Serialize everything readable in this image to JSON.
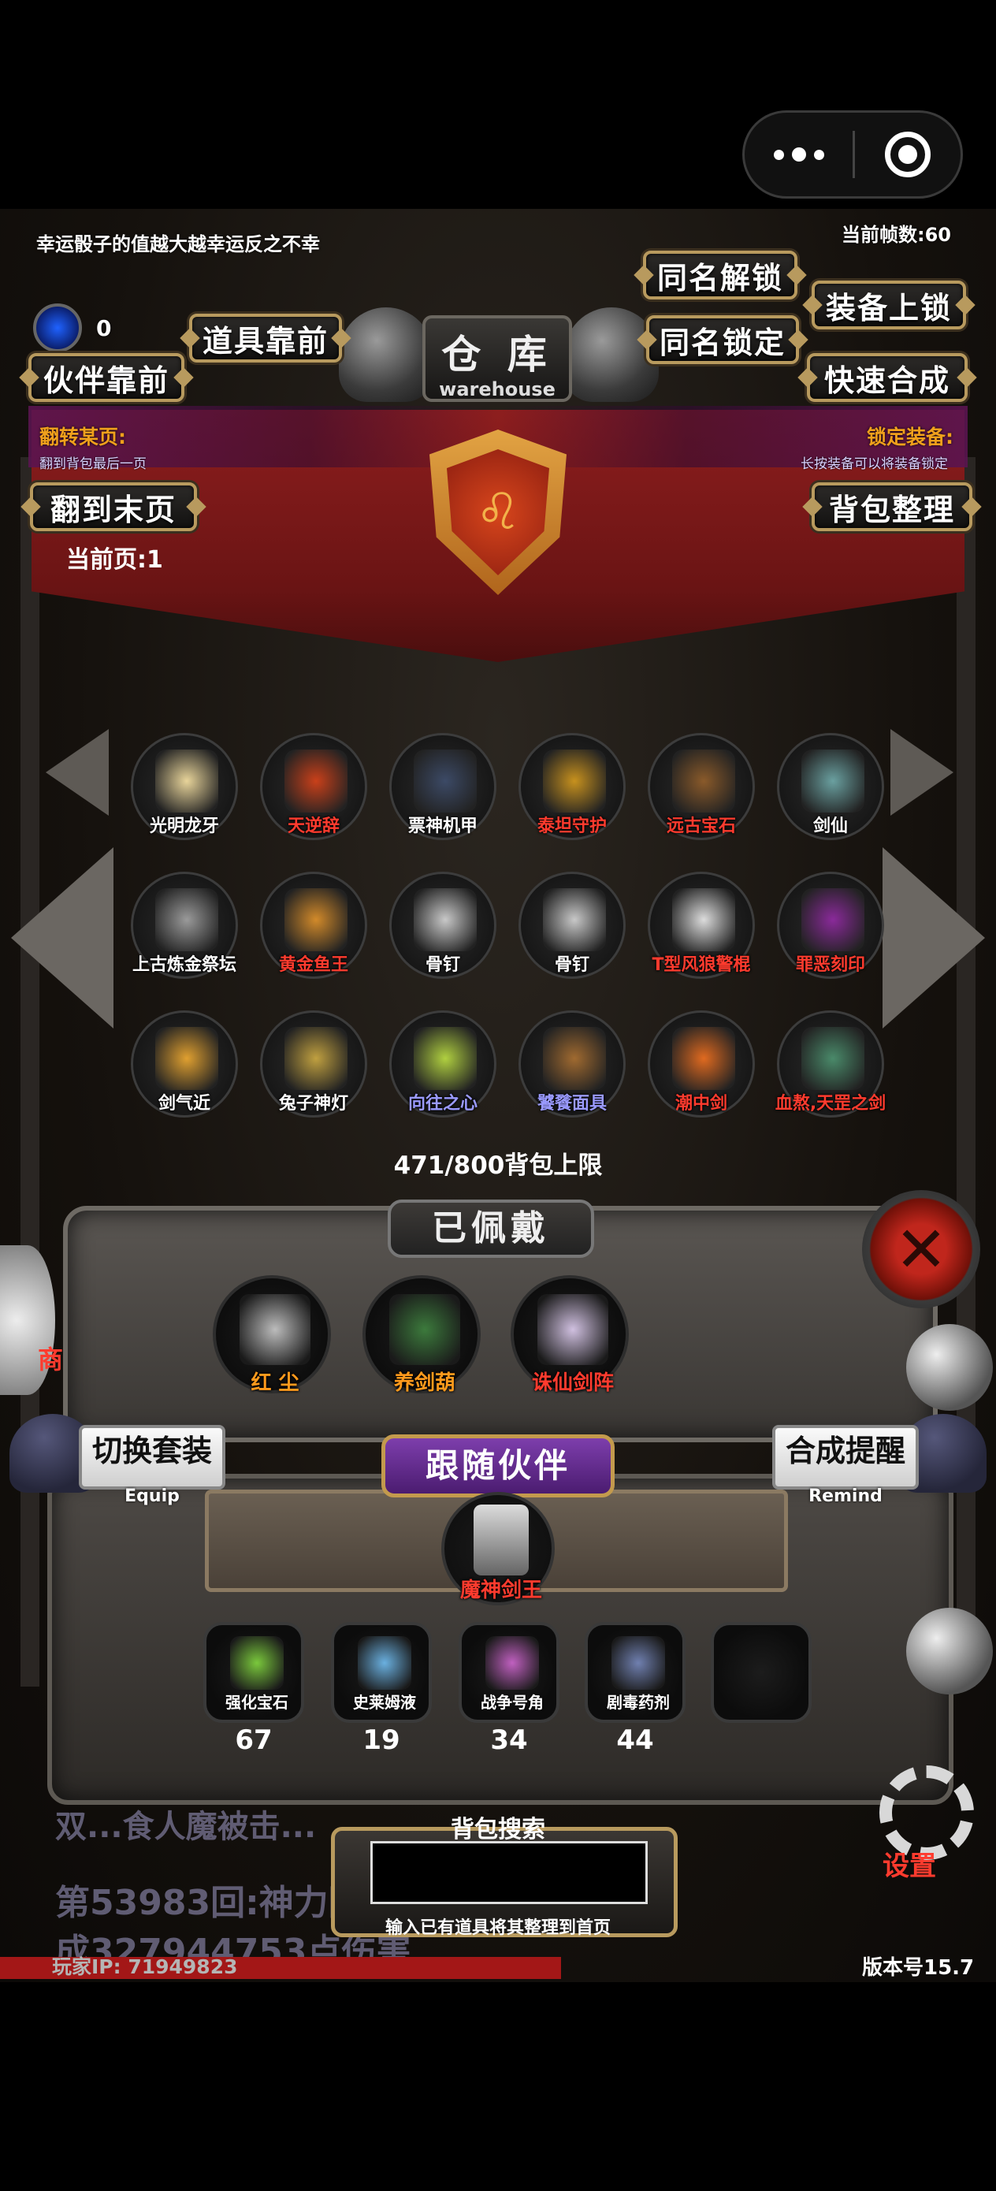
{
  "status": {
    "luck_tip": "幸运骰子的值越大越幸运反之不幸",
    "fps": "当前帧数:60",
    "gem_value": "0"
  },
  "header": {
    "title_zh": "仓 库",
    "title_en": "warehouse"
  },
  "buttons": {
    "item_front": "道具靠前",
    "partner_front": "伙伴靠前",
    "same_name_unlock": "同名解锁",
    "same_name_lock": "同名锁定",
    "equip_lock": "装备上锁",
    "quick_merge": "快速合成",
    "flip_to_last": "翻到末页",
    "bag_sort": "背包整理",
    "switch_suit": "切换套装",
    "switch_suit_sub": "Equip",
    "merge_remind": "合成提醒",
    "merge_remind_sub": "Remind"
  },
  "labels": {
    "flip_page_title": "翻转某页:",
    "flip_page_hint": "翻到背包最后一页",
    "lock_equip_title": "锁定装备:",
    "lock_equip_hint": "长按装备可以将装备锁定",
    "current_page": "当前页:1",
    "capacity": "471/800背包上限",
    "equipped_title": "已佩戴",
    "partner_title": "跟随伙伴",
    "search_title": "背包搜索",
    "search_hint": "输入已有道具将其整理到首页",
    "settings": "设置",
    "ip": "玩家IP:  71949823",
    "version": "版本号15.7",
    "left_shop": "商"
  },
  "inventory": [
    {
      "name": "光明龙牙",
      "color": "#ffffff",
      "icon_color": "#e8d49a"
    },
    {
      "name": "天逆辞",
      "color": "#ff3b2e",
      "icon_color": "#c9401a"
    },
    {
      "name": "票神机甲",
      "color": "#ffffff",
      "icon_color": "#3c4a66"
    },
    {
      "name": "泰坦守护",
      "color": "#ff3b2e",
      "icon_color": "#c7911e"
    },
    {
      "name": "远古宝石",
      "color": "#ff3b2e",
      "icon_color": "#8a5a2a"
    },
    {
      "name": "剑仙",
      "color": "#ffffff",
      "icon_color": "#6aa0a0"
    },
    {
      "name": "上古炼金祭坛",
      "color": "#ffffff",
      "icon_color": "#9a9a9a"
    },
    {
      "name": "黄金鱼王",
      "color": "#ff3b2e",
      "icon_color": "#d28a2a"
    },
    {
      "name": "骨钉",
      "color": "#ffffff",
      "icon_color": "#c8c8c8"
    },
    {
      "name": "骨钉",
      "color": "#ffffff",
      "icon_color": "#c8c8c8"
    },
    {
      "name": "T型风狼警棍",
      "color": "#ff3b2e",
      "icon_color": "#dcdcdc"
    },
    {
      "name": "罪恶刻印",
      "color": "#ff3b2e",
      "icon_color": "#8a2a9a"
    },
    {
      "name": "剑气近",
      "color": "#ffffff",
      "icon_color": "#e0a030"
    },
    {
      "name": "兔子神灯",
      "color": "#ffffff",
      "icon_color": "#c0a040"
    },
    {
      "name": "向往之心",
      "color": "#9a9aff",
      "icon_color": "#b0d040"
    },
    {
      "name": "饕餮面具",
      "color": "#9a9aff",
      "icon_color": "#a06a30"
    },
    {
      "name": "潮中剑",
      "color": "#ff3b2e",
      "icon_color": "#e06a20"
    },
    {
      "name": "血熬,天罡之剑",
      "color": "#ff3b2e",
      "icon_color": "#4a8a6a"
    }
  ],
  "equipped": [
    {
      "name": "红 尘",
      "color": "#ff9a1c",
      "icon_color": "#bcbcbc"
    },
    {
      "name": "养剑葫",
      "color": "#ff9a1c",
      "icon_color": "#3c7a3c"
    },
    {
      "name": "诛仙剑阵",
      "color": "#ff3b2e",
      "icon_color": "#d0c0e0"
    }
  ],
  "partner": {
    "name": "魔神剑王"
  },
  "consumables": [
    {
      "name": "强化宝石",
      "count": "67",
      "icon_color": "#7ac83c"
    },
    {
      "name": "史莱姆液",
      "count": "19",
      "icon_color": "#6ab0e0"
    },
    {
      "name": "战争号角",
      "count": "34",
      "icon_color": "#c060c0"
    },
    {
      "name": "剧毒药剂",
      "count": "44",
      "icon_color": "#7080b0"
    }
  ],
  "log": {
    "line1": "第53983回:神力附...食人魔造",
    "line2": "成327944753点伤害"
  },
  "colors": {
    "accent_gold": "#b89a5e",
    "banner_red": "#8e1e1e",
    "alert_red": "#ff3b2e",
    "label_orange": "#f0a01c"
  }
}
